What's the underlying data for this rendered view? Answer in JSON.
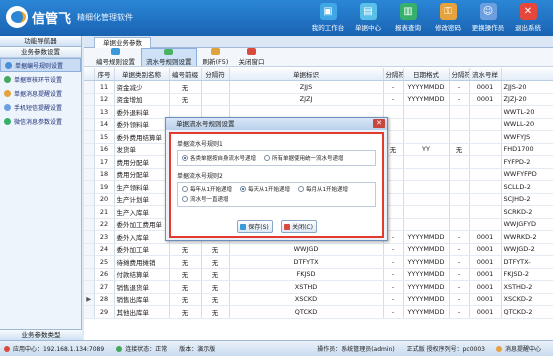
{
  "app": {
    "name": "信管飞",
    "subtitle": "精细化管理软件",
    "nav": [
      {
        "label": "我的工作台",
        "icon": "desk-icon",
        "color": "#3fa7e6"
      },
      {
        "label": "单据中心",
        "icon": "document-icon",
        "color": "#5bc0e8"
      },
      {
        "label": "报表查询",
        "icon": "report-icon",
        "color": "#36b06a"
      },
      {
        "label": "修改密码",
        "icon": "key-icon",
        "color": "#e6a23c"
      },
      {
        "label": "更换操作员",
        "icon": "user-switch-icon",
        "color": "#6d9fe0"
      },
      {
        "label": "退出系统",
        "icon": "exit-icon",
        "color": "#e5473b"
      }
    ]
  },
  "sidebar": {
    "header": "功能导航器",
    "section": "业务参数设置",
    "footer": "业务参数类型",
    "items": [
      {
        "label": "单据编号规则设置",
        "color": "#4a90d9",
        "selected": true
      },
      {
        "label": "单据审核环节设置",
        "color": "#43a85b",
        "selected": false
      },
      {
        "label": "单据消息提醒设置",
        "color": "#e6a23c",
        "selected": false
      },
      {
        "label": "手机短信提醒设置",
        "color": "#6d9fe0",
        "selected": false
      },
      {
        "label": "微信消息参数设置",
        "color": "#36b06a",
        "selected": false
      }
    ]
  },
  "doc_tab": "单据业务参数",
  "toolbar": [
    {
      "label": "编号规则设置",
      "active": false,
      "color": "#3a9ad9"
    },
    {
      "label": "流水号规则设置",
      "active": true,
      "color": "#4bb35f"
    },
    {
      "label": "刷新(F5)",
      "active": false,
      "color": "#e0a23a"
    },
    {
      "label": "关闭窗口",
      "active": false,
      "color": "#d84a3d"
    }
  ],
  "table": {
    "columns": [
      "",
      "序号",
      "单据类别名称",
      "编号前缀",
      "分隔符",
      "单据标识",
      "分隔符",
      "日期格式",
      "分隔符",
      "流水号样",
      ""
    ],
    "rows": [
      {
        "seq": "11",
        "name": "资金减少",
        "prefix": "无",
        "sep1": "",
        "ident": "ZJJS",
        "sep2": "-",
        "date": "YYYYMMDD",
        "sep3": "-",
        "serial": "0001",
        "sample": "ZJJS-20"
      },
      {
        "seq": "12",
        "name": "资金增加",
        "prefix": "无",
        "sep1": "",
        "ident": "ZJZJ",
        "sep2": "-",
        "date": "YYYYMMDD",
        "sep3": "-",
        "serial": "0001",
        "sample": "ZJZJ-20"
      },
      {
        "seq": "13",
        "name": "委外退料单",
        "prefix": "",
        "sep1": "",
        "ident": "",
        "sep2": "",
        "date": "",
        "sep3": "",
        "serial": "",
        "sample": "WWTL-20"
      },
      {
        "seq": "14",
        "name": "委外领料单",
        "prefix": "",
        "sep1": "",
        "ident": "",
        "sep2": "",
        "date": "",
        "sep3": "",
        "serial": "",
        "sample": "WWLL-20"
      },
      {
        "seq": "15",
        "name": "委外费用结算单",
        "prefix": "",
        "sep1": "",
        "ident": "",
        "sep2": "",
        "date": "",
        "sep3": "",
        "serial": "",
        "sample": "WWFYJS"
      },
      {
        "seq": "16",
        "name": "发货单",
        "prefix": "",
        "sep1": "",
        "ident": "",
        "sep2": "无",
        "date": "YY",
        "sep3": "无",
        "serial": "",
        "sample": "FHD1700"
      },
      {
        "seq": "17",
        "name": "费用分配单",
        "prefix": "",
        "sep1": "",
        "ident": "",
        "sep2": "",
        "date": "",
        "sep3": "",
        "serial": "",
        "sample": "FYFPD-2"
      },
      {
        "seq": "18",
        "name": "费用分配单",
        "prefix": "",
        "sep1": "",
        "ident": "",
        "sep2": "",
        "date": "",
        "sep3": "",
        "serial": "",
        "sample": "WWFYFPD"
      },
      {
        "seq": "19",
        "name": "生产领料单",
        "prefix": "",
        "sep1": "",
        "ident": "",
        "sep2": "",
        "date": "",
        "sep3": "",
        "serial": "",
        "sample": "SCLLD-2"
      },
      {
        "seq": "20",
        "name": "生产计划单",
        "prefix": "",
        "sep1": "",
        "ident": "",
        "sep2": "",
        "date": "",
        "sep3": "",
        "serial": "",
        "sample": "SCJHD-2"
      },
      {
        "seq": "21",
        "name": "生产入库单",
        "prefix": "",
        "sep1": "",
        "ident": "",
        "sep2": "",
        "date": "",
        "sep3": "",
        "serial": "",
        "sample": "SCRKD-2"
      },
      {
        "seq": "22",
        "name": "委外加工费用单",
        "prefix": "",
        "sep1": "",
        "ident": "",
        "sep2": "",
        "date": "",
        "sep3": "",
        "serial": "",
        "sample": "WWJGFYD"
      },
      {
        "seq": "23",
        "name": "委外入库单",
        "prefix": "无",
        "sep1": "无",
        "ident": "WWRKD",
        "sep2": "-",
        "date": "YYYYMMDD",
        "sep3": "-",
        "serial": "0001",
        "sample": "WWRKD-2"
      },
      {
        "seq": "24",
        "name": "委外加工单",
        "prefix": "无",
        "sep1": "无",
        "ident": "WWJGD",
        "sep2": "-",
        "date": "YYYYMMDD",
        "sep3": "-",
        "serial": "0001",
        "sample": "WWJGD-2"
      },
      {
        "seq": "25",
        "name": "待摊费用摊销",
        "prefix": "无",
        "sep1": "无",
        "ident": "DTFYTX",
        "sep2": "-",
        "date": "YYYYMMDD",
        "sep3": "-",
        "serial": "0001",
        "sample": "DTFYTX-"
      },
      {
        "seq": "26",
        "name": "付款结算单",
        "prefix": "无",
        "sep1": "无",
        "ident": "FKJSD",
        "sep2": "-",
        "date": "YYYYMMDD",
        "sep3": "-",
        "serial": "0001",
        "sample": "FKJSD-2"
      },
      {
        "seq": "27",
        "name": "销售退货单",
        "prefix": "无",
        "sep1": "无",
        "ident": "XSTHD",
        "sep2": "-",
        "date": "YYYYMMDD",
        "sep3": "-",
        "serial": "0001",
        "sample": "XSTHD-2"
      },
      {
        "seq": "28",
        "name": "销售出库单",
        "prefix": "无",
        "sep1": "无",
        "ident": "XSCKD",
        "sep2": "-",
        "date": "YYYYMMDD",
        "sep3": "-",
        "serial": "0001",
        "sample": "XSCKD-2"
      },
      {
        "seq": "29",
        "name": "其他出库单",
        "prefix": "无",
        "sep1": "无",
        "ident": "QTCKD",
        "sep2": "-",
        "date": "YYYYMMDD",
        "sep3": "-",
        "serial": "0001",
        "sample": "QTCKD-2"
      }
    ],
    "current_row_marker": "▶",
    "current_row_index": 17
  },
  "dialog": {
    "title": "单据流水号规则设置",
    "group1_label": "单据流水号规则1",
    "group1_options": [
      {
        "label": "各类单据按自身流水号递增",
        "checked": true
      },
      {
        "label": "所有单据使用统一流水号递增",
        "checked": false
      }
    ],
    "group2_label": "单据流水号规则2",
    "group2_options": [
      {
        "label": "每年从1开始递增",
        "checked": false
      },
      {
        "label": "每天从1开始递增",
        "checked": true
      },
      {
        "label": "每月从1开始递增",
        "checked": false
      },
      {
        "label": "流水号一直递增",
        "checked": false
      }
    ],
    "save_label": "保存(S)",
    "close_label": "关闭(C)"
  },
  "status": {
    "app_center": "应用中心：192.168.1.134:7089",
    "link": "连接状态：正常",
    "version": "版本：演示版",
    "operator": "操作员：系统管理员(admin)",
    "license": "正式版  授权序列号：pc0003",
    "reminder": "消息提醒中心"
  }
}
